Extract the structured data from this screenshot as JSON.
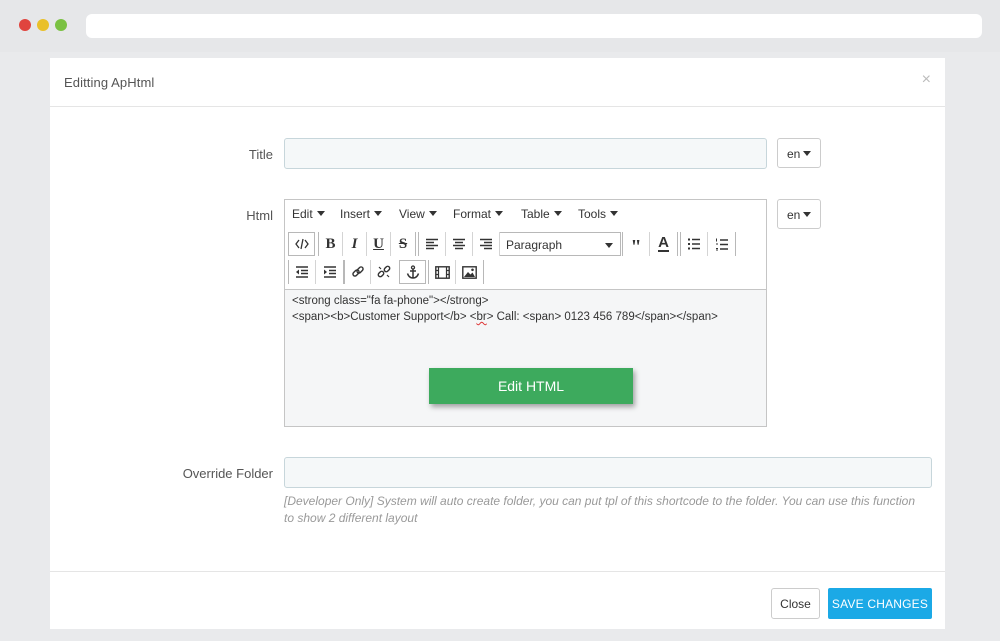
{
  "modal": {
    "title": "Editting ApHtml",
    "close_glyph": "×"
  },
  "form": {
    "title_label": "Title",
    "title_value": "",
    "title_lang": "en",
    "html_label": "Html",
    "html_lang": "en",
    "override_label": "Override Folder",
    "override_value": "",
    "override_help": "[Developer Only] System will auto create folder, you can put tpl of this shortcode to the folder. You can use this function to show 2 different layout"
  },
  "editor": {
    "menus": [
      "Edit",
      "Insert",
      "View",
      "Format",
      "Table",
      "Tools"
    ],
    "format_select": "Paragraph",
    "toolbar_icons": [
      "source-code-icon",
      "bold-icon",
      "italic-icon",
      "underline-icon",
      "strikethrough-icon",
      "align-left-icon",
      "align-center-icon",
      "align-right-icon",
      "blockquote-icon",
      "text-color-icon",
      "bullet-list-icon",
      "numbered-list-icon",
      "outdent-icon",
      "indent-icon",
      "link-icon",
      "unlink-icon",
      "anchor-icon",
      "media-icon",
      "image-icon"
    ],
    "content_line1": "<strong class=\"fa fa-phone\"></strong>",
    "content_line2_a": "<span><b>Customer Support</b> <",
    "content_line2_b": "br",
    "content_line2_c": "> Call: <span>   0123 456 789</span></span>",
    "edit_html_button": "Edit HTML"
  },
  "footer": {
    "close_label": "Close",
    "save_label": "SAVE CHANGES"
  },
  "colors": {
    "save_button": "#1ba9e6",
    "edit_html_button": "#3daa5d"
  }
}
